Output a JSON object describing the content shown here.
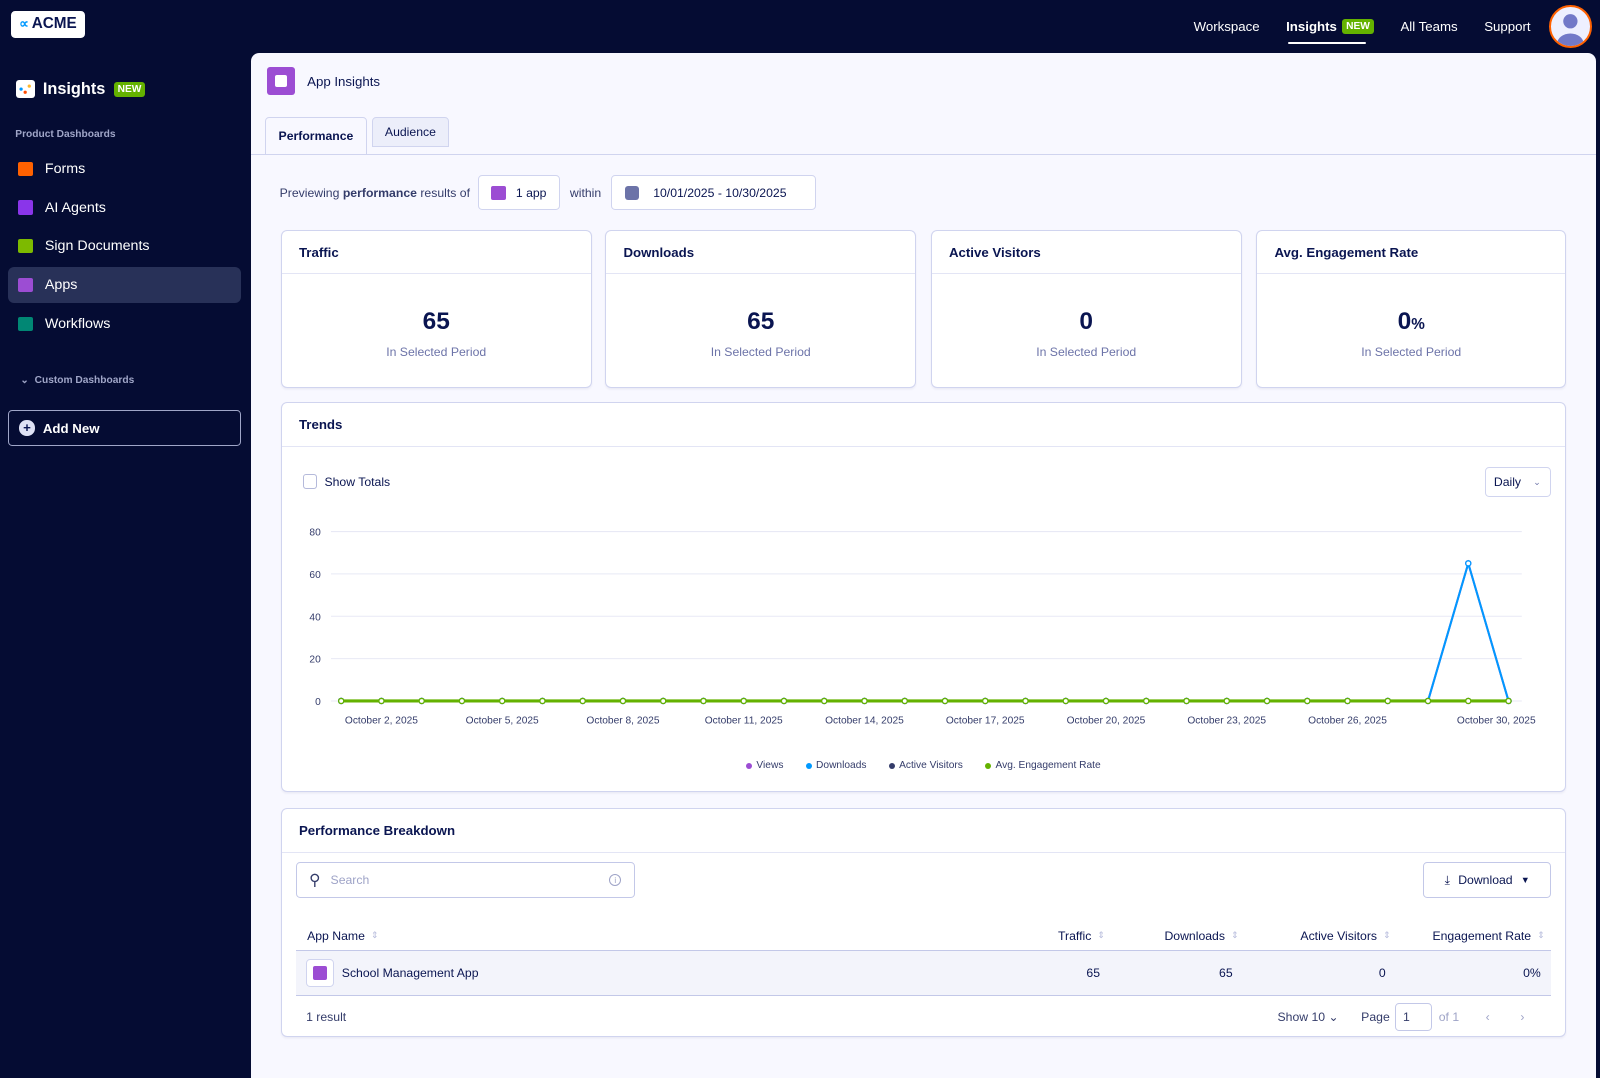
{
  "topbar": {
    "logo": "ACME",
    "nav": [
      {
        "label": "Workspace"
      },
      {
        "label": "Insights",
        "badge": "NEW",
        "active": true
      },
      {
        "label": "All Teams"
      },
      {
        "label": "Support"
      }
    ]
  },
  "sidebar": {
    "title": "Insights",
    "badge": "NEW",
    "section": "Product Dashboards",
    "items": [
      {
        "label": "Forms",
        "color": "#ff6100"
      },
      {
        "label": "AI Agents",
        "color": "#8a35ea"
      },
      {
        "label": "Sign Documents",
        "color": "#7dba00"
      },
      {
        "label": "Apps",
        "color": "#9c4dd3",
        "selected": true
      },
      {
        "label": "Workflows",
        "color": "#018774"
      }
    ],
    "custom": "Custom Dashboards",
    "add_new": "Add New"
  },
  "header": {
    "title": "App Insights"
  },
  "tabs": [
    {
      "label": "Performance",
      "active": true
    },
    {
      "label": "Audience"
    }
  ],
  "filter": {
    "prefix": "Previewing",
    "bold": "performance",
    "suffix": "results of",
    "apps": "1 app",
    "within": "within",
    "date_range": "10/01/2025 - 10/30/2025"
  },
  "stats": [
    {
      "title": "Traffic",
      "value": "65",
      "unit": "",
      "sub": "In Selected Period"
    },
    {
      "title": "Downloads",
      "value": "65",
      "unit": "",
      "sub": "In Selected Period"
    },
    {
      "title": "Active Visitors",
      "value": "0",
      "unit": "",
      "sub": "In Selected Period"
    },
    {
      "title": "Avg. Engagement Rate",
      "value": "0",
      "unit": "%",
      "sub": "In Selected Period"
    }
  ],
  "trends": {
    "title": "Trends",
    "show_totals": "Show Totals",
    "interval": "Daily"
  },
  "chart_data": {
    "type": "line",
    "ylim": [
      0,
      80
    ],
    "yticks": [
      0,
      20,
      40,
      60,
      80
    ],
    "grid": true,
    "legend": "bottom",
    "x": [
      "2025-10-01",
      "2025-10-02",
      "2025-10-03",
      "2025-10-04",
      "2025-10-05",
      "2025-10-06",
      "2025-10-07",
      "2025-10-08",
      "2025-10-09",
      "2025-10-10",
      "2025-10-11",
      "2025-10-12",
      "2025-10-13",
      "2025-10-14",
      "2025-10-15",
      "2025-10-16",
      "2025-10-17",
      "2025-10-18",
      "2025-10-19",
      "2025-10-20",
      "2025-10-21",
      "2025-10-22",
      "2025-10-23",
      "2025-10-24",
      "2025-10-25",
      "2025-10-26",
      "2025-10-27",
      "2025-10-28",
      "2025-10-29",
      "2025-10-30"
    ],
    "xtick_labels": [
      {
        "index": 1,
        "label": "October 2, 2025"
      },
      {
        "index": 4,
        "label": "October 5, 2025"
      },
      {
        "index": 7,
        "label": "October 8, 2025"
      },
      {
        "index": 10,
        "label": "October 11, 2025"
      },
      {
        "index": 13,
        "label": "October 14, 2025"
      },
      {
        "index": 16,
        "label": "October 17, 2025"
      },
      {
        "index": 19,
        "label": "October 20, 2025"
      },
      {
        "index": 22,
        "label": "October 23, 2025"
      },
      {
        "index": 25,
        "label": "October 26, 2025"
      },
      {
        "index": 29,
        "label": "October 30, 2025"
      }
    ],
    "series": [
      {
        "name": "Views",
        "color": "#9c4dd3",
        "values": [
          0,
          0,
          0,
          0,
          0,
          0,
          0,
          0,
          0,
          0,
          0,
          0,
          0,
          0,
          0,
          0,
          0,
          0,
          0,
          0,
          0,
          0,
          0,
          0,
          0,
          0,
          0,
          0,
          65,
          0
        ]
      },
      {
        "name": "Downloads",
        "color": "#0099ff",
        "values": [
          0,
          0,
          0,
          0,
          0,
          0,
          0,
          0,
          0,
          0,
          0,
          0,
          0,
          0,
          0,
          0,
          0,
          0,
          0,
          0,
          0,
          0,
          0,
          0,
          0,
          0,
          0,
          0,
          65,
          0
        ]
      },
      {
        "name": "Active Visitors",
        "color": "#343c6a",
        "values": [
          0,
          0,
          0,
          0,
          0,
          0,
          0,
          0,
          0,
          0,
          0,
          0,
          0,
          0,
          0,
          0,
          0,
          0,
          0,
          0,
          0,
          0,
          0,
          0,
          0,
          0,
          0,
          0,
          0,
          0
        ]
      },
      {
        "name": "Avg. Engagement Rate",
        "color": "#64b200",
        "values": [
          0,
          0,
          0,
          0,
          0,
          0,
          0,
          0,
          0,
          0,
          0,
          0,
          0,
          0,
          0,
          0,
          0,
          0,
          0,
          0,
          0,
          0,
          0,
          0,
          0,
          0,
          0,
          0,
          0,
          0
        ]
      }
    ]
  },
  "breakdown": {
    "title": "Performance Breakdown",
    "search_placeholder": "Search",
    "download": "Download",
    "columns": [
      "App Name",
      "Traffic",
      "Downloads",
      "Active Visitors",
      "Engagement Rate"
    ],
    "rows": [
      {
        "name": "School Management App",
        "traffic": "65",
        "downloads": "65",
        "visitors": "0",
        "rate": "0%"
      }
    ],
    "result_count": "1 result",
    "show": "Show 10",
    "page_label": "Page",
    "page": "1",
    "of": "of 1"
  }
}
